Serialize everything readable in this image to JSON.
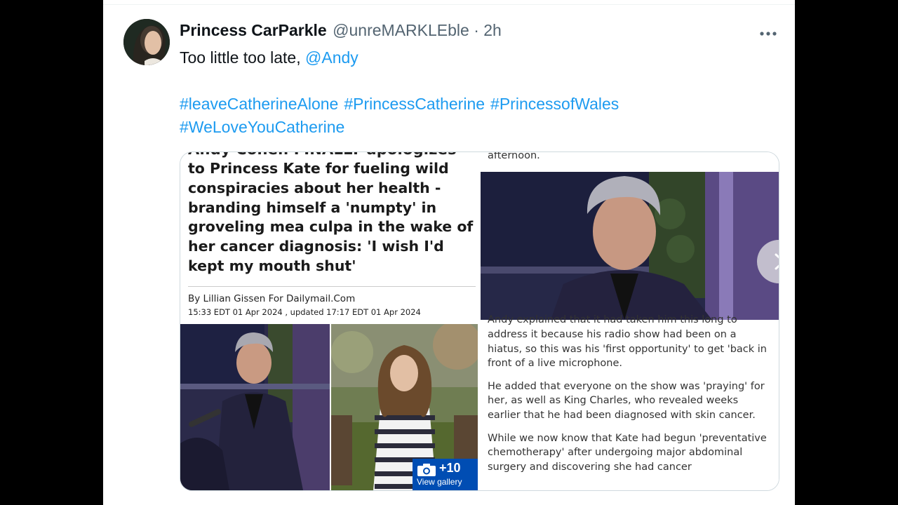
{
  "tweet": {
    "display_name": "Princess CarParkle",
    "handle": "@unreMARKLEble · 2h",
    "text_prefix": "Too little too late, ",
    "mention": "@Andy",
    "hashtags": [
      "#leaveCatherineAlone",
      "#PrincessCatherine",
      "#PrincessofWales",
      "#WeLoveYouCatherine"
    ]
  },
  "article": {
    "headline_cut": "Andy Cohen FINALLY apologizes",
    "headline": "to Princess Kate for fueling wild conspiracies about her health - branding himself a 'numpty' in groveling mea culpa in the wake of her cancer diagnosis: 'I wish I'd kept my mouth shut'",
    "byline": "By Lillian Gissen For Dailymail.Com",
    "dateline": "15:33 EDT 01 Apr 2024 , updated 17:17 EDT 01 Apr 2024",
    "gallery_count": "+10",
    "gallery_label": "View gallery",
    "top_text": "afternoon.",
    "cut_text": "Andy explained that it had taken him this long to",
    "paragraphs": [
      "address it because his radio show had been on a hiatus, so this was his 'first opportunity' to get 'back in front of a live microphone.",
      "He added that everyone on the show was 'praying' for her, as well as King Charles, who revealed weeks earlier that he had been diagnosed with skin cancer.",
      "While we now know that Kate had begun 'preventative chemotherapy' after undergoing major abdominal surgery and discovering she had cancer"
    ]
  },
  "colors": {
    "link": "#1d9bf0",
    "gallery_badge": "#004db3"
  },
  "icons": {
    "more": "more-horizontal-icon",
    "next": "chevron-right-icon",
    "camera": "camera-icon"
  }
}
